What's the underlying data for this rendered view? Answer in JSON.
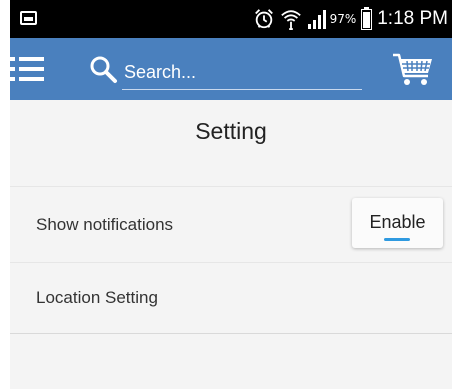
{
  "status_bar": {
    "battery_percent": "97%",
    "time": "1:18 PM",
    "icons": [
      "image-notification-icon",
      "alarm-icon",
      "wifi-icon",
      "signal-icon",
      "battery-icon"
    ]
  },
  "app_bar": {
    "background_color": "#4a80be",
    "search_placeholder": "Search...",
    "icons": [
      "menu-icon",
      "search-icon",
      "cart-icon"
    ]
  },
  "page": {
    "title": "Setting"
  },
  "settings": {
    "rows": [
      {
        "label": "Show notifications",
        "action_label": "Enable",
        "indicator_color": "#2f9ae0"
      },
      {
        "label": "Location Setting"
      }
    ]
  }
}
